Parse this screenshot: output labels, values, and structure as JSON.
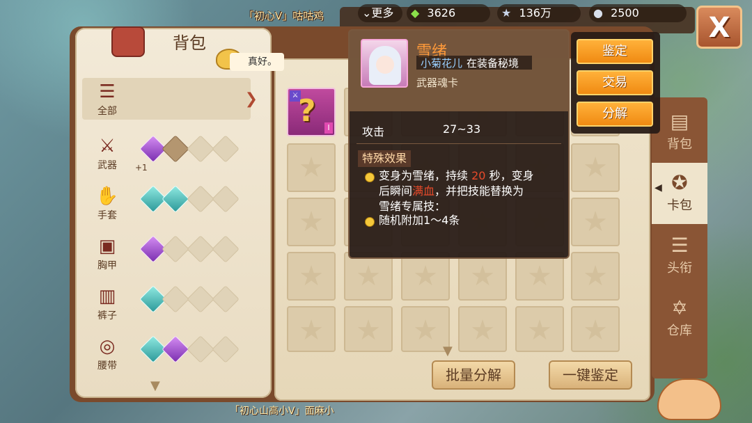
{
  "top_player_name": "「初心V」咕咕鸡",
  "bottom_player_name": "「初心山高小V」面麻小",
  "resources": {
    "more_label": "更多",
    "gem_value": "3626",
    "star_value": "136万",
    "shell_value": "2500"
  },
  "bag": {
    "title": "背包",
    "chat_message": "真好。"
  },
  "categories": [
    {
      "label": "全部"
    },
    {
      "label": "武器",
      "extra": "+1"
    },
    {
      "label": "手套"
    },
    {
      "label": "胸甲"
    },
    {
      "label": "裤子"
    },
    {
      "label": "腰带"
    }
  ],
  "buttons": {
    "batch_decompose": "批量分解",
    "one_click_appraise": "一键鉴定"
  },
  "side_nav": [
    {
      "label": "背包"
    },
    {
      "label": "卡包"
    },
    {
      "label": "头衔"
    },
    {
      "label": "仓库"
    }
  ],
  "tooltip": {
    "name": "雪绪",
    "owner_name": "小菊花儿",
    "owner_suffix": "在装备秘境",
    "type": "武器魂卡",
    "attr_label": "攻击",
    "attr_value": "27~33",
    "special_title": "特殊效果",
    "effect1_a": "变身为雪绪，持续",
    "effect1_num": "20",
    "effect1_b": "秒，变身",
    "effect1_c": "后瞬间",
    "effect1_hl": "满血",
    "effect1_d": "，并把技能替换为",
    "effect1_e": "雪绪专属技：",
    "effect2": "随机附加1～4条",
    "card_roman": "I"
  },
  "tooltip_menu": {
    "appraise": "鉴定",
    "trade": "交易",
    "decompose": "分解"
  },
  "icons": [
    "chevron-down-icon",
    "gem-icon",
    "star-icon",
    "shell-icon",
    "close-icon",
    "bag-icon",
    "lamp-icon",
    "list-icon",
    "sword-icon",
    "glove-icon",
    "armor-icon",
    "pants-icon",
    "belt-icon",
    "scroll-icon",
    "hexagram-icon",
    "card-icon"
  ],
  "colors": {
    "name_orange": "#ff9a3a",
    "highlight_red": "#e84a2a",
    "button_orange": "#f08a12"
  }
}
